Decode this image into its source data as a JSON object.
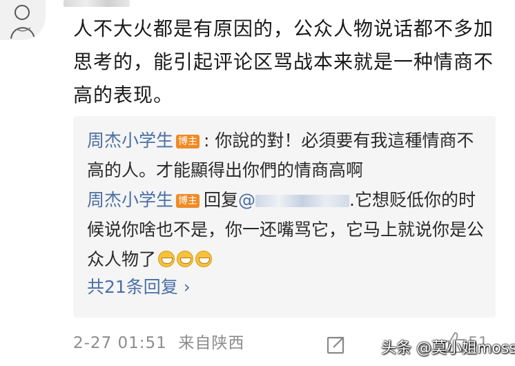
{
  "comment": {
    "text": "人不大火都是有原因的，公众人物说话都不多加思考的，能引起评论区骂战本来就是一种情商不高的表现。"
  },
  "replies": [
    {
      "author": "周杰小学生",
      "badge": "博主",
      "separator": ": ",
      "text": "你說的對！必須要有我這種情商不高的人。才能顯得出你們的情商高啊"
    },
    {
      "author": "周杰小学生",
      "badge": "博主",
      "reply_prefix": "回复",
      "mention_prefix": "@",
      "text": ".它想贬低你的时候说你啥也不是，你一还嘴骂它，它马上就说你是公众人物了",
      "emoji_name": "grin-emoji"
    }
  ],
  "more_replies": {
    "label": "共21条回复",
    "chevron": "›"
  },
  "footer": {
    "timestamp": "2-27 01:51",
    "location": "来自陕西",
    "like_count": "51"
  },
  "watermark": "头条 @莫小姐moss",
  "colors": {
    "link": "#4a6fa5",
    "badge": "#f08a24",
    "reply_bg": "#f5f5f5",
    "meta": "#8c8c8c"
  }
}
